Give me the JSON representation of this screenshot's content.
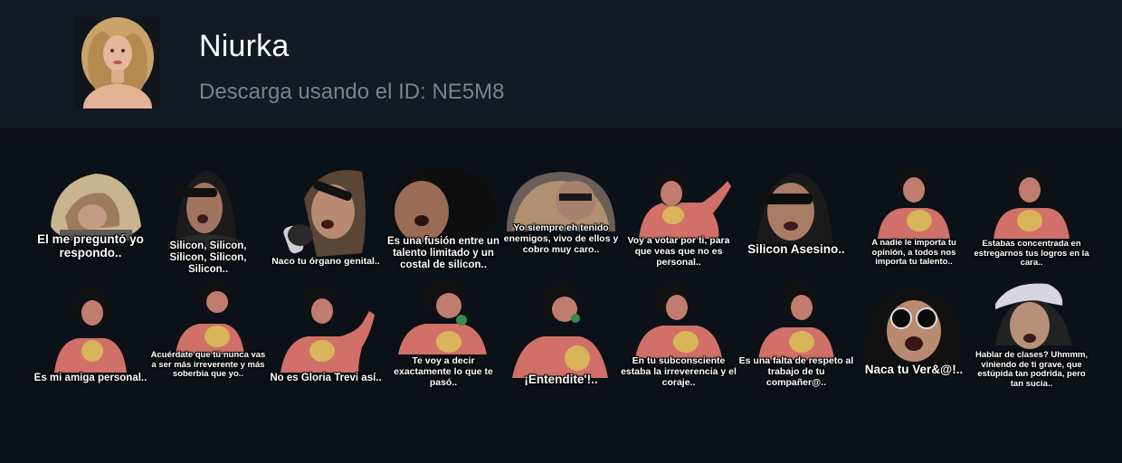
{
  "pack": {
    "name": "Niurka",
    "download_hint": "Descarga usando el ID: NE5M8"
  },
  "colors": {
    "header_bg": "#141a21",
    "page_bg": "#0c1117",
    "title": "#ffffff",
    "subtitle": "#7c8189"
  },
  "stickers": [
    {
      "caption": "El me preguntó yo respondo.."
    },
    {
      "caption": "Silicon, Silicon, Silicon, Silicon, Silicon.."
    },
    {
      "caption": "Naco tu órgano genital.."
    },
    {
      "caption": "Es una fusión entre un talento limitado y un costal de silicon.."
    },
    {
      "caption": "Yo siempre eh tenido enemigos, vivo de ellos y cobro muy caro.."
    },
    {
      "caption": "Voy a votar por ti, para que veas que no es personal.."
    },
    {
      "caption": "Silicon Asesino.."
    },
    {
      "caption": "A nadie le importa tu opinión, a todos nos importa tu talento.."
    },
    {
      "caption": "Estabas concentrada en estregarnos tus logros en la cara.."
    },
    {
      "caption": "Es mi amiga personal.."
    },
    {
      "caption": "Acuérdate que tú nunca vas a ser más irreverente y más soberbia que yo.."
    },
    {
      "caption": "No es Gloria Trevi así.."
    },
    {
      "caption": "Te voy a decir exactamente lo que te pasó.."
    },
    {
      "caption": "¡Entendite'!.."
    },
    {
      "caption": "En tu subconsciente estaba la irreverencia y el coraje.."
    },
    {
      "caption": "Es una falta de respeto al trabajo de tu compañer@.."
    },
    {
      "caption": "Naca tu Ver&@!.."
    },
    {
      "caption": "Hablar de clases? Uhmmm, viniendo de ti grave, que estúpida tan podrida, pero tan sucia.."
    }
  ]
}
